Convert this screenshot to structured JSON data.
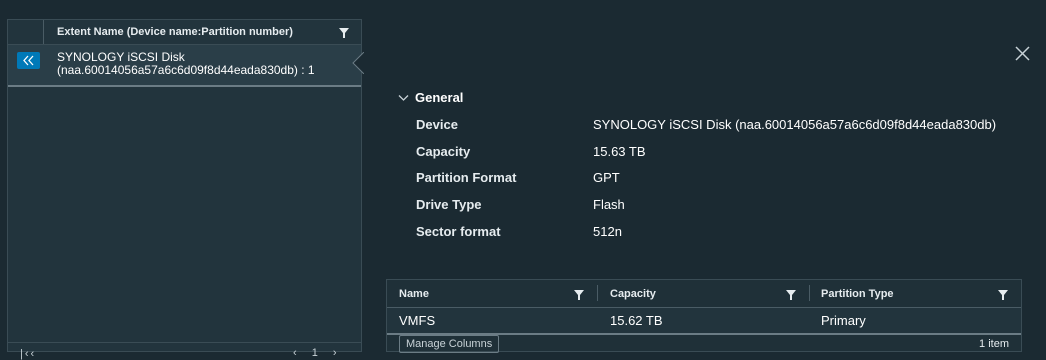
{
  "left_panel": {
    "column_header": "Extent Name (Device name:Partition number)",
    "rows": [
      {
        "name": "SYNOLOGY iSCSI Disk (naa.60014056a57a6c6d09f8d44eada830db) : 1"
      }
    ]
  },
  "details": {
    "section_title": "General",
    "properties": [
      {
        "label": "Device",
        "value": "SYNOLOGY iSCSI Disk (naa.60014056a57a6c6d09f8d44eada830db)"
      },
      {
        "label": "Capacity",
        "value": "15.63 TB"
      },
      {
        "label": "Partition Format",
        "value": "GPT"
      },
      {
        "label": "Drive Type",
        "value": "Flash"
      },
      {
        "label": "Sector format",
        "value": "512n"
      }
    ],
    "partitions": {
      "columns": [
        "Name",
        "Capacity",
        "Partition Type"
      ],
      "rows": [
        {
          "name": "VMFS",
          "capacity": "15.62 TB",
          "type": "Primary"
        }
      ],
      "manage_columns_label": "Manage Columns",
      "item_count": "1 item"
    }
  },
  "colors": {
    "background": "#1b2a32",
    "panel": "#22343d",
    "accent": "#0079b8"
  },
  "icons": [
    "filter-icon",
    "double-chevron-left-icon",
    "close-icon",
    "chevron-down-icon"
  ]
}
